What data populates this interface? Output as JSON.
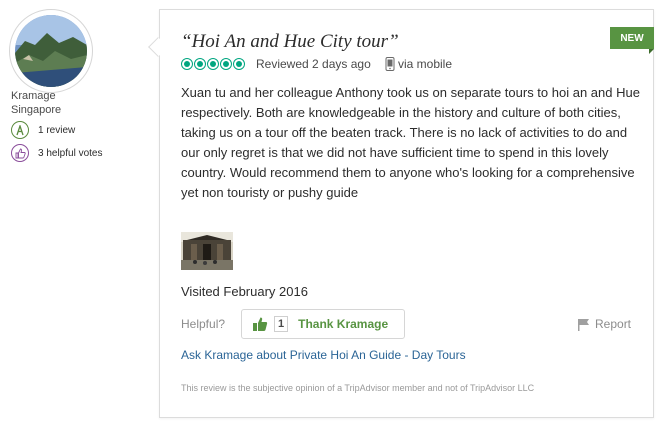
{
  "reviewer": {
    "username": "Kramage",
    "location": "Singapore",
    "reviews_count": "1 review",
    "helpful_votes": "3 helpful votes"
  },
  "review": {
    "new_tag": "NEW",
    "title": "“Hoi An and Hue City tour”",
    "rating": 5,
    "reviewed": "Reviewed 2 days ago",
    "via_mobile": "via mobile",
    "body": "Xuan tu and her colleague Anthony took us on separate tours to hoi an and Hue respectively. Both are knowledgeable in the history and culture of both cities, taking us on a tour off the beaten track. There is no lack of activities to do and our only regret is that we did not have sufficient time to spend in this lovely country. Would recommend them to anyone who's looking for a comprehensive yet non touristy or pushy guide",
    "visited": "Visited February 2016"
  },
  "actions": {
    "helpful_label": "Helpful?",
    "thank_count": "1",
    "thank_label": "Thank Kramage",
    "report_label": "Report",
    "ask_link": "Ask Kramage about Private Hoi An Guide - Day Tours"
  },
  "disclaimer": "This review is the subjective opinion of a TripAdvisor member and not of TripAdvisor LLC",
  "colors": {
    "brand_green": "#589442",
    "bubble_green": "#00a680",
    "link_blue": "#2a6496",
    "muted_gray": "#8c8c8c"
  }
}
